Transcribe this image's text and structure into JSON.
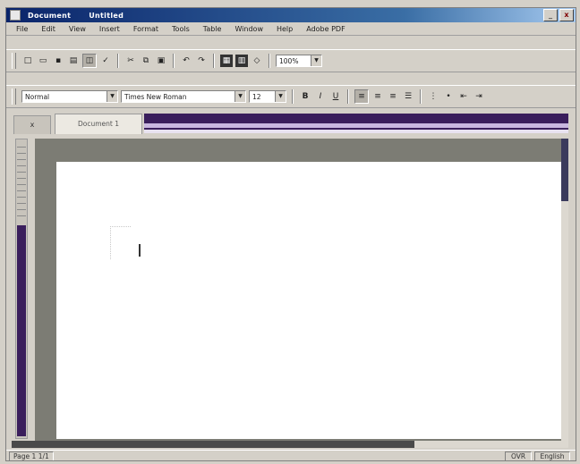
{
  "titlebar": {
    "app_name": "Document",
    "doc_name": "Untitled",
    "minimize": "_",
    "close": "x"
  },
  "menubar": {
    "items": [
      "File",
      "Edit",
      "View",
      "Insert",
      "Format",
      "Tools",
      "Table",
      "Window",
      "Help",
      "Adobe PDF"
    ]
  },
  "standard_toolbar": {
    "zoom_value": "100%"
  },
  "format_toolbar": {
    "style_value": "Normal",
    "font_value": "Times New Roman",
    "size_value": "12",
    "bold": "B",
    "italic": "I",
    "underline": "U"
  },
  "tabs": {
    "inactive": "x",
    "active": "Document 1"
  },
  "statusbar": {
    "page_info": "Page 1 1/1",
    "ovr": "OVR",
    "ins": "English"
  },
  "icons": [
    "document-icon",
    "new-icon",
    "open-icon",
    "save-icon",
    "print-icon",
    "preview-icon",
    "spelling-icon",
    "cut-icon",
    "copy-icon",
    "paste-icon",
    "undo-icon",
    "redo-icon",
    "table-icon",
    "columns-icon",
    "drawing-icon",
    "align-left-icon",
    "align-center-icon",
    "align-right-icon",
    "justify-icon",
    "bullets-icon",
    "numbering-icon",
    "indent-icon",
    "outdent-icon"
  ],
  "colors": {
    "titlebar": "#0a246a",
    "ruler": "#3a1e5c",
    "gutter": "#7c7c74"
  }
}
